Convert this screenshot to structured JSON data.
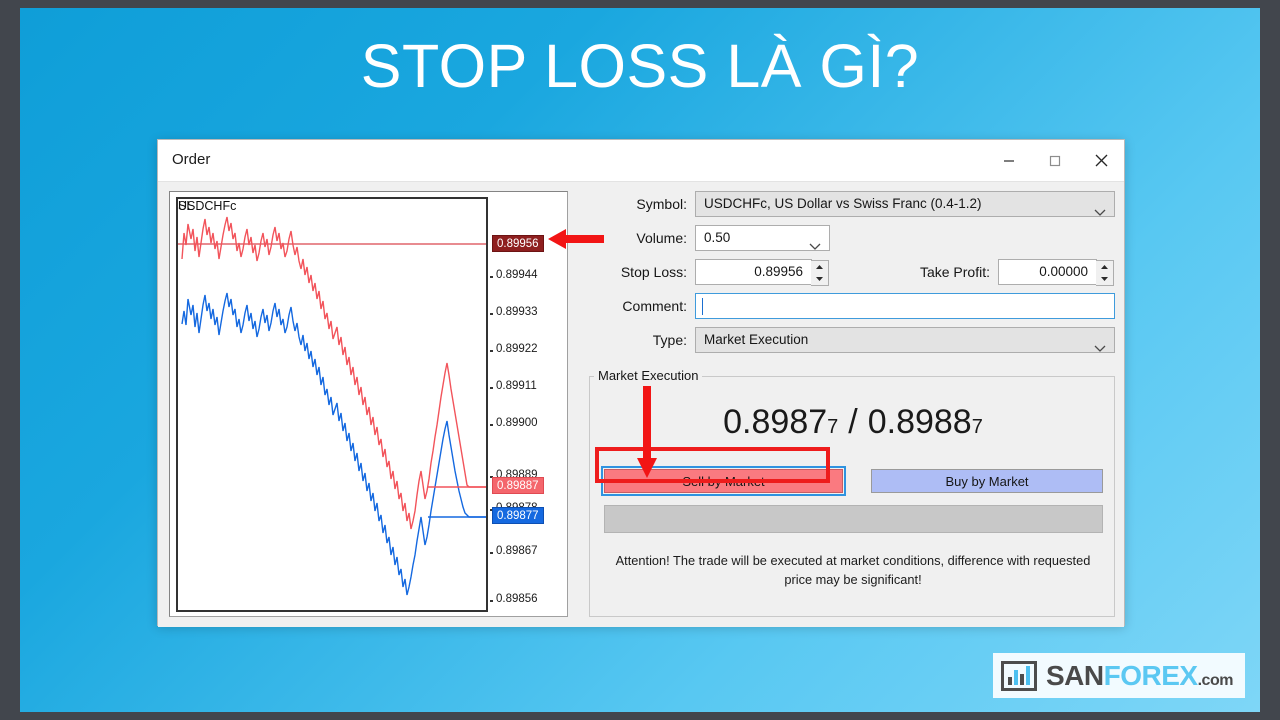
{
  "slide": {
    "title": "STOP LOSS LÀ GÌ?",
    "background_from": "#0f9ed8",
    "background_to": "#7ed6f7",
    "frame_color": "#42464d"
  },
  "dialog": {
    "title": "Order",
    "window_buttons": {
      "minimize": "minimize-icon",
      "maximize": "maximize-icon",
      "close": "close-icon"
    }
  },
  "chart": {
    "symbol_label": "USDCHFc",
    "sl_label": "SL",
    "ticks": [
      "0.89944",
      "0.89933",
      "0.89922",
      "0.89911",
      "0.89900",
      "0.89889",
      "0.89878",
      "0.89867",
      "0.89856"
    ],
    "sl_badge": "0.89956",
    "ask_badge": "0.89887",
    "bid_badge": "0.89877",
    "ask_color": "#f4666c",
    "bid_color": "#1569e0",
    "sl_color": "#8e1f1f"
  },
  "form": {
    "symbol_label": "Symbol:",
    "symbol_value": "USDCHFc, US Dollar vs Swiss Franc (0.4-1.2)",
    "volume_label": "Volume:",
    "volume_value": "0.50",
    "stop_loss_label": "Stop Loss:",
    "stop_loss_value": "0.89956",
    "take_profit_label": "Take Profit:",
    "take_profit_value": "0.00000",
    "comment_label": "Comment:",
    "comment_value": "",
    "comment_placeholder": "",
    "type_label": "Type:",
    "type_value": "Market Execution"
  },
  "market_execution": {
    "group_label": "Market Execution",
    "bid_price_main": "0.8987",
    "bid_price_sub": "7",
    "separator": "/",
    "ask_price_main": "0.8988",
    "ask_price_sub": "7",
    "sell_button": "Sell by Market",
    "buy_button": "Buy by Market",
    "attention": "Attention! The trade will be executed at market conditions, difference with requested price may be significant!"
  },
  "annotations": {
    "arrow_to_sl_badge": "left-arrow-icon",
    "arrow_to_sell_button": "down-arrow-icon",
    "highlight_color": "#ee1c1c"
  },
  "logo": {
    "san": "SAN",
    "forex": "FOREX",
    "com": ".com"
  }
}
